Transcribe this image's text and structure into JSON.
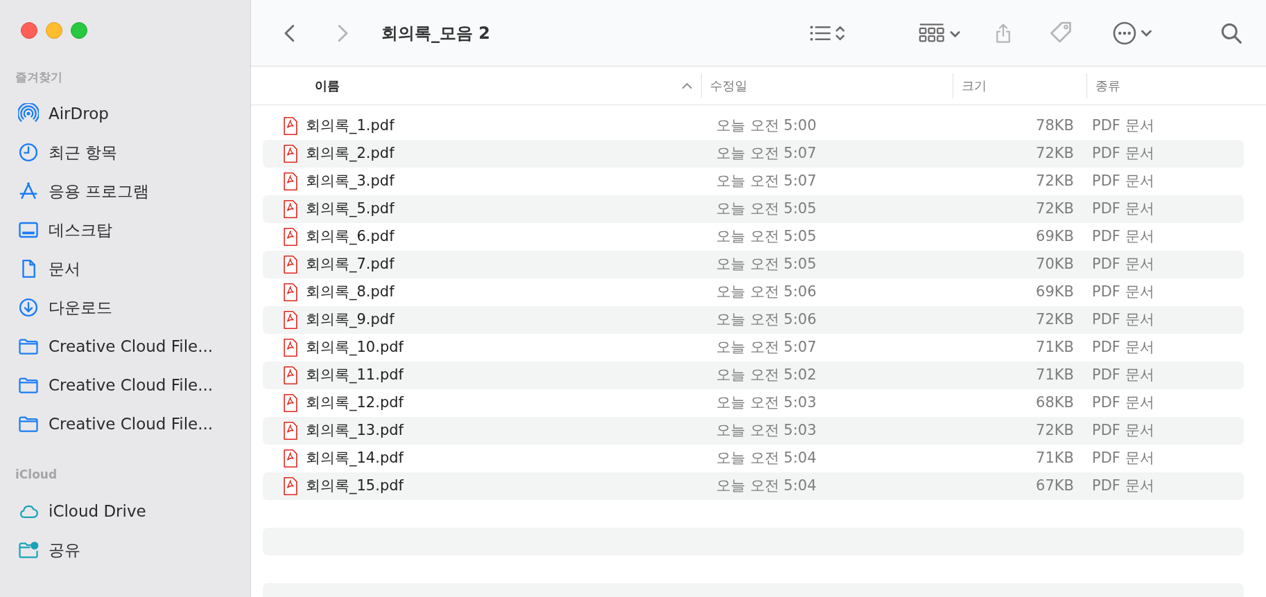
{
  "window": {
    "title": "회의록_모음 2"
  },
  "sidebar": {
    "sections": [
      {
        "title": "즐겨찾기",
        "items": [
          {
            "label": "AirDrop",
            "kind": "airdrop",
            "color": "#1a7cf5"
          },
          {
            "label": "최근 항목",
            "kind": "clock",
            "color": "#1a7cf5"
          },
          {
            "label": "응용 프로그램",
            "kind": "apps",
            "color": "#1a7cf5"
          },
          {
            "label": "데스크탑",
            "kind": "desktop",
            "color": "#1a7cf5"
          },
          {
            "label": "문서",
            "kind": "document",
            "color": "#1a7cf5"
          },
          {
            "label": "다운로드",
            "kind": "download",
            "color": "#1a7cf5"
          },
          {
            "label": "Creative Cloud File...",
            "kind": "folder",
            "color": "#1a7cf5"
          },
          {
            "label": "Creative Cloud File...",
            "kind": "folder",
            "color": "#1a7cf5"
          },
          {
            "label": "Creative Cloud File...",
            "kind": "folder",
            "color": "#1a7cf5"
          }
        ]
      },
      {
        "title": "iCloud",
        "items": [
          {
            "label": "iCloud Drive",
            "kind": "cloud",
            "color": "#19a3b8"
          },
          {
            "label": "공유",
            "kind": "shared-folder",
            "color": "#19a3b8"
          }
        ]
      }
    ]
  },
  "table": {
    "columns": [
      {
        "label": "이름",
        "sorted": true
      },
      {
        "label": "수정일",
        "sorted": false
      },
      {
        "label": "크기",
        "sorted": false
      },
      {
        "label": "종류",
        "sorted": false
      }
    ],
    "rows": [
      {
        "name": "회의록_1.pdf",
        "modified": "오늘 오전 5:00",
        "size": "78KB",
        "kind": "PDF 문서"
      },
      {
        "name": "회의록_2.pdf",
        "modified": "오늘 오전 5:07",
        "size": "72KB",
        "kind": "PDF 문서"
      },
      {
        "name": "회의록_3.pdf",
        "modified": "오늘 오전 5:07",
        "size": "72KB",
        "kind": "PDF 문서"
      },
      {
        "name": "회의록_5.pdf",
        "modified": "오늘 오전 5:05",
        "size": "72KB",
        "kind": "PDF 문서"
      },
      {
        "name": "회의록_6.pdf",
        "modified": "오늘 오전 5:05",
        "size": "69KB",
        "kind": "PDF 문서"
      },
      {
        "name": "회의록_7.pdf",
        "modified": "오늘 오전 5:05",
        "size": "70KB",
        "kind": "PDF 문서"
      },
      {
        "name": "회의록_8.pdf",
        "modified": "오늘 오전 5:06",
        "size": "69KB",
        "kind": "PDF 문서"
      },
      {
        "name": "회의록_9.pdf",
        "modified": "오늘 오전 5:06",
        "size": "72KB",
        "kind": "PDF 문서"
      },
      {
        "name": "회의록_10.pdf",
        "modified": "오늘 오전 5:07",
        "size": "71KB",
        "kind": "PDF 문서"
      },
      {
        "name": "회의록_11.pdf",
        "modified": "오늘 오전 5:02",
        "size": "71KB",
        "kind": "PDF 문서"
      },
      {
        "name": "회의록_12.pdf",
        "modified": "오늘 오전 5:03",
        "size": "68KB",
        "kind": "PDF 문서"
      },
      {
        "name": "회의록_13.pdf",
        "modified": "오늘 오전 5:03",
        "size": "72KB",
        "kind": "PDF 문서"
      },
      {
        "name": "회의록_14.pdf",
        "modified": "오늘 오전 5:04",
        "size": "71KB",
        "kind": "PDF 문서"
      },
      {
        "name": "회의록_15.pdf",
        "modified": "오늘 오전 5:04",
        "size": "67KB",
        "kind": "PDF 문서"
      }
    ]
  }
}
